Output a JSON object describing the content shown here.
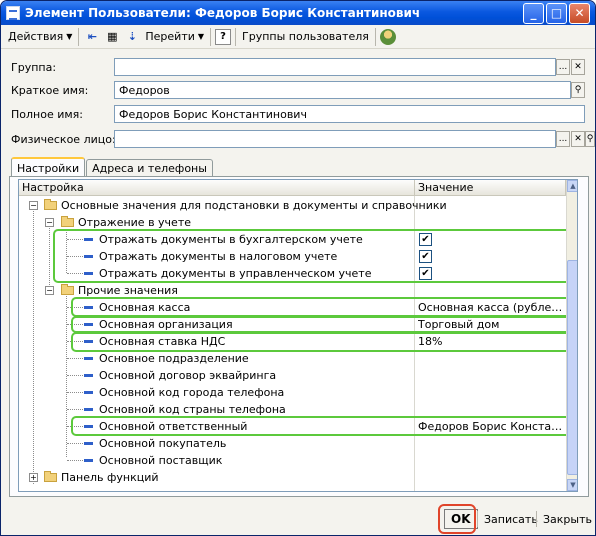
{
  "window": {
    "title": "Элемент Пользователи: Федоров Борис Константинович",
    "min_glyph": "_",
    "max_glyph": "□",
    "close_glyph": "✕"
  },
  "toolbar": {
    "actions_label": "Действия",
    "goto_label": "Перейти",
    "help_glyph": "?",
    "user_groups_label": "Группы пользователя"
  },
  "form": {
    "group_label": "Группа:",
    "group_value": "",
    "short_name_label": "Краткое имя:",
    "short_name_value": "Федоров",
    "full_name_label": "Полное имя:",
    "full_name_value": "Федоров Борис Константинович",
    "person_label": "Физическое лицо:",
    "person_value": "",
    "select_glyph": "...",
    "clear_glyph": "✕",
    "search_glyph": "🔍"
  },
  "tabs": [
    {
      "label": "Настройки",
      "active": true
    },
    {
      "label": "Адреса и телефоны",
      "active": false
    }
  ],
  "grid": {
    "col_setting": "Настройка",
    "col_value": "Значение",
    "rows": [
      {
        "label": "Основные значения для подстановки в документы и справочники",
        "value": "",
        "kind": "folder",
        "level": 0,
        "expanded": true
      },
      {
        "label": "Отражение в учете",
        "value": "",
        "kind": "folder",
        "level": 1,
        "expanded": true
      },
      {
        "label": "Отражать документы в бухгалтерском учете",
        "value": "✔",
        "kind": "check",
        "level": 2
      },
      {
        "label": "Отражать документы в налоговом учете",
        "value": "✔",
        "kind": "check",
        "level": 2
      },
      {
        "label": "Отражать документы в управленческом учете",
        "value": "✔",
        "kind": "check",
        "level": 2
      },
      {
        "label": "Прочие значения",
        "value": "",
        "kind": "folder",
        "level": 1,
        "expanded": true
      },
      {
        "label": "Основная касса",
        "value": "Основная касса (рублевая)",
        "kind": "leaf",
        "level": 2
      },
      {
        "label": "Основная организация",
        "value": "Торговый дом",
        "kind": "leaf",
        "level": 2
      },
      {
        "label": "Основная ставка НДС",
        "value": "18%",
        "kind": "leaf",
        "level": 2
      },
      {
        "label": "Основное подразделение",
        "value": "",
        "kind": "leaf",
        "level": 2
      },
      {
        "label": "Основной договор эквайринга",
        "value": "",
        "kind": "leaf",
        "level": 2
      },
      {
        "label": "Основной код города телефона",
        "value": "",
        "kind": "leaf",
        "level": 2
      },
      {
        "label": "Основной код страны телефона",
        "value": "",
        "kind": "leaf",
        "level": 2
      },
      {
        "label": "Основной ответственный",
        "value": "Федоров Борис Константи...",
        "kind": "leaf",
        "level": 2
      },
      {
        "label": "Основной покупатель",
        "value": "",
        "kind": "leaf",
        "level": 2
      },
      {
        "label": "Основной поставщик",
        "value": "",
        "kind": "leaf",
        "level": 2
      },
      {
        "label": "Панель функций",
        "value": "",
        "kind": "folder",
        "level": 0,
        "expanded": false
      }
    ]
  },
  "buttons": {
    "ok_label": "OK",
    "save_label": "Записать",
    "close_label": "Закрыть"
  },
  "colors": {
    "highlight_green": "#5cc93c",
    "highlight_red": "#e0442a",
    "title_blue": "#0a58e0"
  }
}
